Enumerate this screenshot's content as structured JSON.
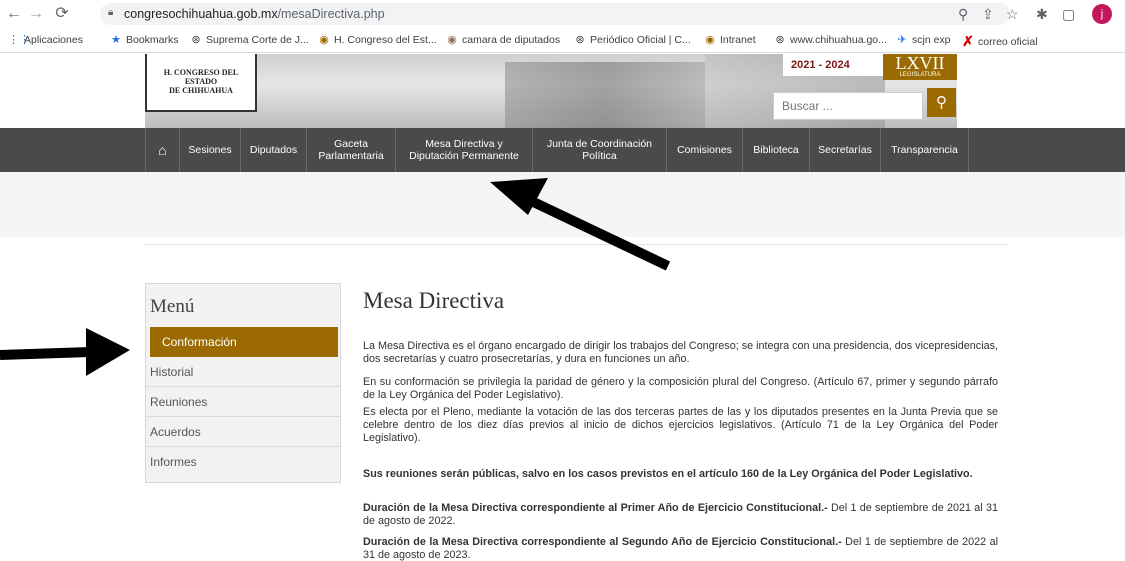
{
  "browser": {
    "url_host": "congresochihuahua.gob.mx",
    "url_path": "/mesaDirectiva.php",
    "avatar_letter": "j",
    "bookmarks": [
      {
        "icon": "apps-icon",
        "label": "Aplicaciones"
      },
      {
        "icon": "star-icon",
        "label": "Bookmarks"
      },
      {
        "icon": "globe-icon",
        "label": "Suprema Corte de J..."
      },
      {
        "icon": "seal-icon",
        "label": "H. Congreso del Est..."
      },
      {
        "icon": "seal-icon",
        "label": "camara de diputados"
      },
      {
        "icon": "globe-icon",
        "label": "Periódico Oficial | C..."
      },
      {
        "icon": "seal-icon",
        "label": "Intranet"
      },
      {
        "icon": "globe-icon",
        "label": "www.chihuahua.go..."
      },
      {
        "icon": "bird-icon",
        "label": "scjn exp"
      },
      {
        "icon": "x-icon",
        "label": "correo oficial"
      }
    ]
  },
  "header": {
    "logo_line1": "H. CONGRESO DEL ESTADO",
    "logo_line2": "DE CHIHUAHUA",
    "years": "2021 - 2024",
    "legislatura": "LXVII",
    "legislatura_sub": "LEGISLATURA",
    "search_placeholder": "Buscar ..."
  },
  "nav": {
    "items": [
      {
        "label": "Sesiones"
      },
      {
        "label": "Diputados"
      },
      {
        "label": "Gaceta Parlamentaria"
      },
      {
        "label": "Mesa Directiva y Diputación Permanente"
      },
      {
        "label": "Junta de Coordinación Política"
      },
      {
        "label": "Comisiones"
      },
      {
        "label": "Biblioteca"
      },
      {
        "label": "Secretarías"
      },
      {
        "label": "Transparencia"
      }
    ]
  },
  "sidebar": {
    "title": "Menú",
    "items": [
      {
        "label": "Conformación",
        "active": true
      },
      {
        "label": "Historial"
      },
      {
        "label": "Reuniones"
      },
      {
        "label": "Acuerdos"
      },
      {
        "label": "Informes"
      }
    ]
  },
  "main": {
    "title": "Mesa Directiva",
    "p1": "La Mesa Directiva es el órgano encargado de dirigir los trabajos del Congreso; se integra con una presidencia, dos vicepresidencias, dos secretarías y cuatro prosecretarías, y dura en funciones un año.",
    "p2": "En su conformación se privilegia la paridad de género y la composición plural del Congreso. (Artículo 67, primer y segundo párrafo de la Ley Orgánica del Poder Legislativo).",
    "p3": "Es electa por el Pleno, mediante la votación de las dos terceras partes de las y los diputados presentes en la Junta Previa que se celebre dentro de los diez días previos al inicio de dichos ejercicios legislativos. (Artículo 71 de la Ley Orgánica del Poder Legislativo).",
    "p4": "Sus reuniones serán públicas, salvo en los casos previstos en el artículo 160 de la Ley Orgánica del Poder Legislativo.",
    "p5_bold": "Duración de la Mesa Directiva correspondiente al Primer Año de Ejercicio Constitucional.-",
    "p5_rest": " Del 1 de septiembre de 2021 al 31 de agosto de 2022.",
    "p6_bold": "Duración de la Mesa Directiva correspondiente al Segundo Año de Ejercicio Constitucional.-",
    "p6_rest": " Del 1 de septiembre de 2022 al 31 de agosto de 2023."
  },
  "colors": {
    "accent": "#9b6a00",
    "nav_bg": "#4a4a4a"
  }
}
